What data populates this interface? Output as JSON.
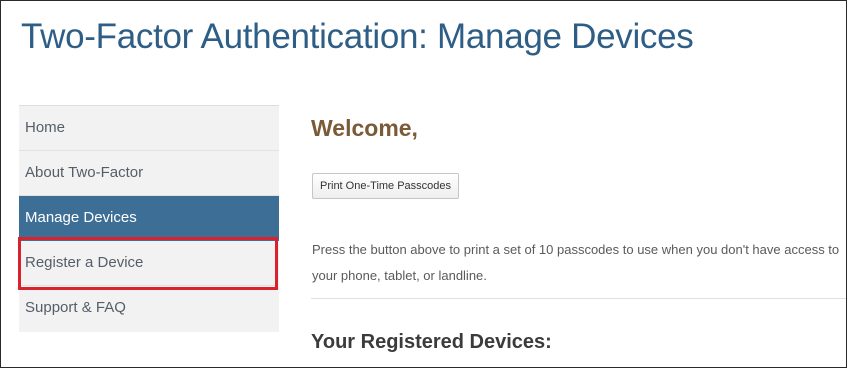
{
  "page": {
    "title": "Two-Factor Authentication: Manage Devices"
  },
  "sidebar": {
    "items": [
      {
        "label": "Home",
        "active": false
      },
      {
        "label": "About Two-Factor",
        "active": false
      },
      {
        "label": "Manage Devices",
        "active": true
      },
      {
        "label": "Register a Device",
        "active": false,
        "highlighted": true
      },
      {
        "label": "Support & FAQ",
        "active": false
      }
    ]
  },
  "main": {
    "welcome": "Welcome,",
    "print_button_label": "Print One-Time Passcodes",
    "description": "Press the button above to print a set of 10 passcodes to use when you don't have access to your phone, tablet, or landline.",
    "registered_heading": "Your Registered Devices:"
  },
  "colors": {
    "title": "#2e5e86",
    "active_nav_bg": "#3d6f96",
    "welcome_text": "#7b5a38",
    "highlight_border": "#d8232f",
    "sidebar_bg": "#f2f2f2"
  }
}
